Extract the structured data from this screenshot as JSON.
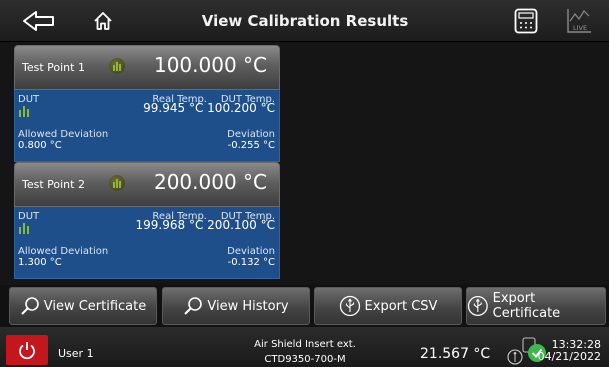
{
  "header": {
    "title": "View Calibration Results",
    "back_icon": "back-arrow-icon",
    "home_icon": "home-icon",
    "calculator_icon": "calculator-icon",
    "live_label": "LIVE"
  },
  "test_points": [
    {
      "name": "Test Point 1",
      "setpoint": "100.000 °C",
      "labels": {
        "dut": "DUT",
        "real": "Real Temp.",
        "dut_temp": "DUT Temp.",
        "allowed": "Allowed Deviation",
        "deviation": "Deviation"
      },
      "real_temp": "99.945 °C",
      "dut_temp": "100.200 °C",
      "allowed_deviation": "0.800 °C",
      "deviation": "-0.255 °C"
    },
    {
      "name": "Test Point 2",
      "setpoint": "200.000 °C",
      "labels": {
        "dut": "DUT",
        "real": "Real Temp.",
        "dut_temp": "DUT Temp.",
        "allowed": "Allowed Deviation",
        "deviation": "Deviation"
      },
      "real_temp": "199.968 °C",
      "dut_temp": "200.100 °C",
      "allowed_deviation": "1.300 °C",
      "deviation": "-0.132 °C"
    }
  ],
  "actions": {
    "view_certificate": "View Certificate",
    "view_history": "View History",
    "export_csv": "Export CSV",
    "export_certificate": "Export Certificate"
  },
  "status": {
    "user": "User 1",
    "probe_line1": "Air Shield Insert ext.",
    "probe_line2": "CTD9350-700-M",
    "temperature": "21.567 °C",
    "time": "13:32:28",
    "date": "04/21/2022"
  },
  "colors": {
    "card_blue": "#1f4f8a",
    "power_red": "#c4161c",
    "ok_green": "#3cb94a",
    "icon_olive": "#8ab83a"
  }
}
